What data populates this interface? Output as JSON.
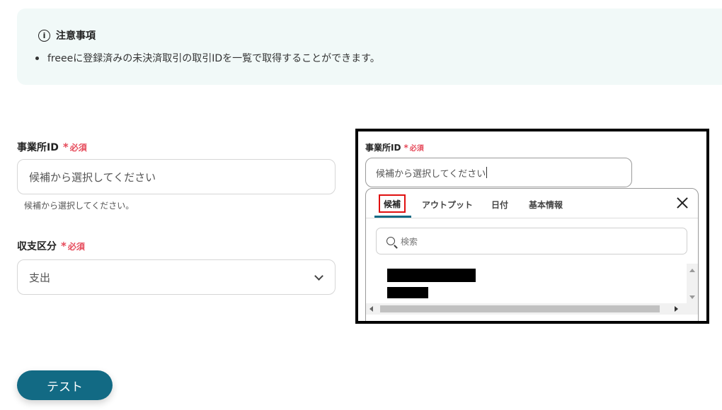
{
  "notice": {
    "title": "注意事項",
    "items": [
      "freeeに登録済みの未決済取引の取引IDを一覧で取得することができます。"
    ]
  },
  "form": {
    "office_id": {
      "label": "事業所ID",
      "required_mark": "*",
      "required_text": "必須",
      "placeholder": "候補から選択してください",
      "hint": "候補から選択してください。"
    },
    "income_type": {
      "label": "収支区分",
      "required_mark": "*",
      "required_text": "必須",
      "value": "支出"
    },
    "test_button": "テスト"
  },
  "inset": {
    "label": "事業所ID",
    "required_mark": "*",
    "required_text": "必須",
    "input_value": "候補から選択してください",
    "tabs": [
      "候補",
      "アウトプット",
      "日付",
      "基本情報"
    ],
    "active_tab": "候補",
    "search_placeholder": "検索"
  },
  "colors": {
    "accent": "#126a84",
    "required": "#e64a5a",
    "notice_bg": "#f1f9f8",
    "highlight": "#e01010"
  }
}
